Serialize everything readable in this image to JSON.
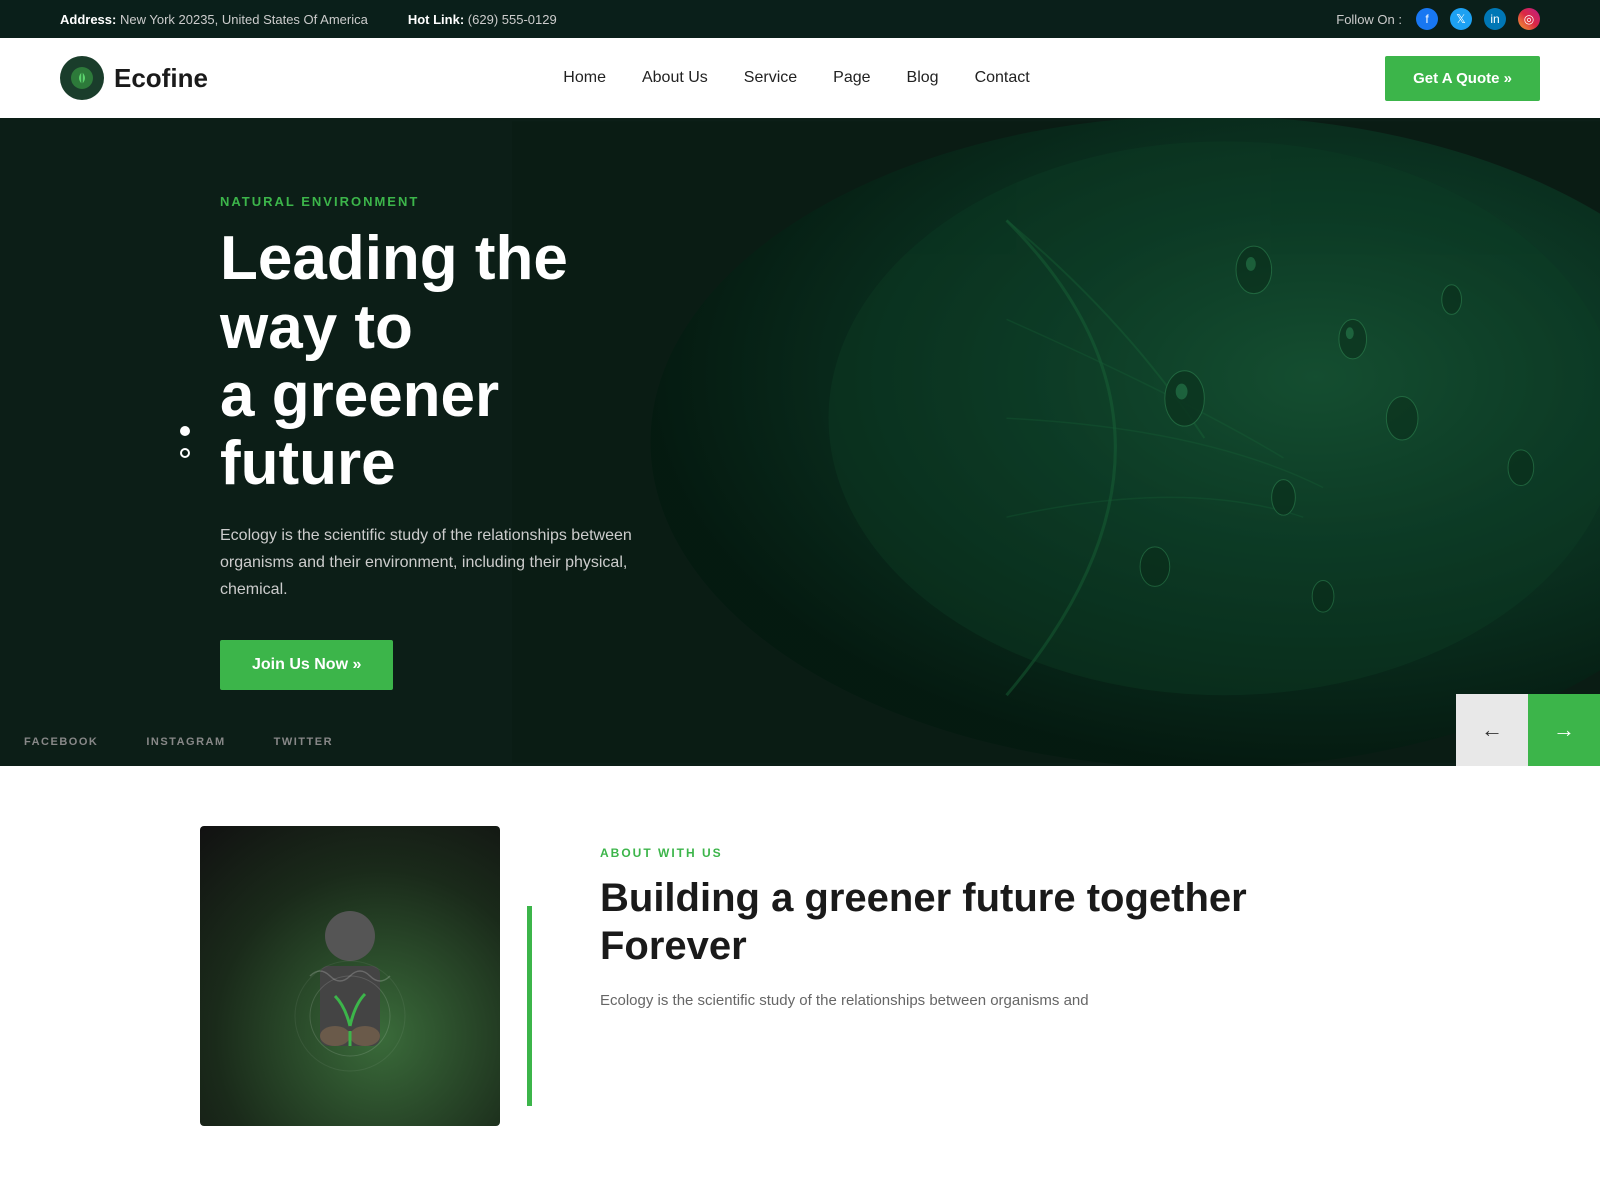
{
  "topbar": {
    "address_label": "Address:",
    "address_value": "New York 20235, United States Of America",
    "hotlink_label": "Hot Link:",
    "hotlink_value": "(629) 555-0129",
    "follow_label": "Follow On :",
    "social": [
      {
        "name": "facebook",
        "icon": "f"
      },
      {
        "name": "twitter",
        "icon": "t"
      },
      {
        "name": "linkedin",
        "icon": "in"
      },
      {
        "name": "instagram",
        "icon": "◎"
      }
    ]
  },
  "navbar": {
    "logo_text": "Ecofine",
    "links": [
      {
        "label": "Home",
        "id": "home"
      },
      {
        "label": "About Us",
        "id": "about"
      },
      {
        "label": "Service",
        "id": "service"
      },
      {
        "label": "Page",
        "id": "page"
      },
      {
        "label": "Blog",
        "id": "blog"
      },
      {
        "label": "Contact",
        "id": "contact"
      }
    ],
    "cta_label": "Get A Quote »"
  },
  "hero": {
    "subtitle": "NATURAL ENVIRONMENT",
    "title_line1": "Leading the way to",
    "title_line2": "a greener future",
    "description": "Ecology is the scientific study of the relationships between organisms and their environment, including their physical, chemical.",
    "cta_label": "Join Us Now »",
    "dots": [
      {
        "active": true
      },
      {
        "active": false
      }
    ],
    "social_links": [
      {
        "label": "FACEBOOK"
      },
      {
        "label": "INSTAGRAM"
      },
      {
        "label": "TWITTER"
      }
    ],
    "arrow_prev": "←",
    "arrow_next": "→"
  },
  "about": {
    "subtitle": "ABOUT WITH US",
    "title": "Building a greener future together Forever",
    "description": "Ecology is the scientific study of the relationships between organisms and"
  },
  "colors": {
    "green": "#3cb54a",
    "dark": "#0c1e17"
  }
}
